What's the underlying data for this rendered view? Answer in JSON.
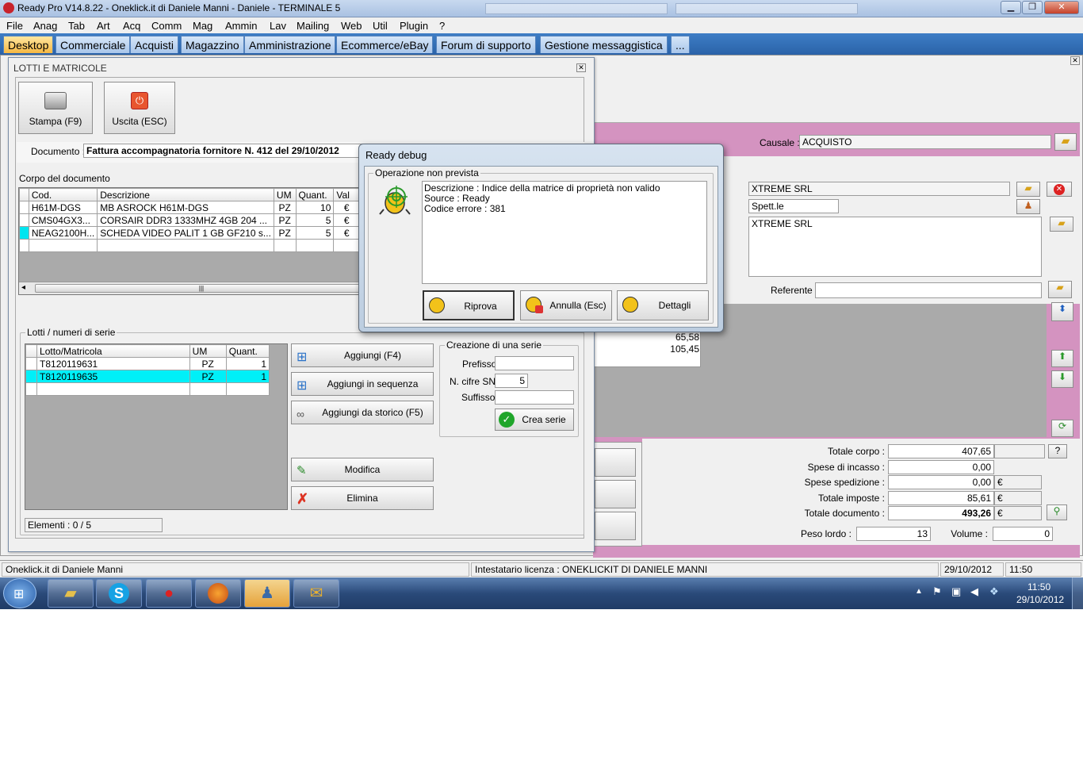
{
  "window": {
    "title": "Ready Pro V14.8.22 - Oneklick.it di Daniele Manni - Daniele - TERMINALE 5"
  },
  "menu": [
    "File",
    "Anag",
    "Tab",
    "Art",
    "Acq",
    "Comm",
    "Mag",
    "Ammin",
    "Lav",
    "Mailing",
    "Web",
    "Util",
    "Plugin",
    "?"
  ],
  "tabs": [
    "Desktop",
    "Commerciale",
    "Acquisti",
    "Magazzino",
    "Amministrazione",
    "Ecommerce/eBay",
    "Forum di supporto",
    "Gestione messaggistica",
    "..."
  ],
  "lotti": {
    "title": "LOTTI E MATRICOLE",
    "stampa_label": "Stampa (F9)",
    "uscita_label": "Uscita (ESC)",
    "documento_label": "Documento :",
    "documento_value": "Fattura accompagnatoria fornitore N. 412 del 29/10/2012",
    "corpo_label": "Corpo del documento",
    "corpo_headers": [
      "Cod.",
      "Descrizione",
      "UM",
      "Quant.",
      "Val"
    ],
    "corpo_rows": [
      [
        "H61M-DGS",
        "MB ASROCK H61M-DGS",
        "PZ",
        "10",
        "€"
      ],
      [
        "CMS04GX3...",
        "CORSAIR DDR3 1333MHZ 4GB 204 ...",
        "PZ",
        "5",
        "€"
      ],
      [
        "NEAG2100H...",
        "SCHEDA VIDEO PALIT 1 GB GF210 s...",
        "PZ",
        "5",
        "€"
      ]
    ],
    "serie_label": "Lotti / numeri di serie",
    "serie_headers": [
      "Lotto/Matricola",
      "UM",
      "Quant."
    ],
    "serie_rows": [
      [
        "T8120119631",
        "PZ",
        "1"
      ],
      [
        "T8120119635",
        "PZ",
        "1"
      ]
    ],
    "aggiungi_label": "Aggiungi (F4)",
    "aggiungi_seq_label": "Aggiungi in sequenza",
    "aggiungi_storico_label": "Aggiungi da storico (F5)",
    "modifica_label": "Modifica",
    "elimina_label": "Elimina",
    "creazione_label": "Creazione di una serie",
    "prefisso_label": "Prefisso",
    "ncifre_label": "N. cifre SN",
    "ncifre_value": "5",
    "suffisso_label": "Suffisso",
    "crea_serie_label": "Crea serie",
    "elementi": "Elementi : 0 / 5"
  },
  "document": {
    "causale_label": "Causale :",
    "causale_value": "ACQUISTO",
    "fornitore": "XTREME SRL",
    "titolo": "Spett.le",
    "indirizzo": "XTREME SRL",
    "referente_label": "Referente",
    "grid_values": [
      "65,58",
      "105,45"
    ],
    "totale_corpo_label": "Totale corpo :",
    "totale_corpo": "407,65",
    "spese_incasso_label": "Spese di incasso :",
    "spese_incasso": "0,00",
    "spese_spedizione_label": "Spese spedizione :",
    "spese_spedizione": "0,00",
    "totale_imposte_label": "Totale imposte :",
    "totale_imposte": "85,61",
    "totale_documento_label": "Totale documento :",
    "totale_documento": "493,26",
    "currency": "€",
    "help": "?",
    "peso_label": "Peso lordo :",
    "peso_value": "13",
    "volume_label": "Volume :",
    "volume_value": "0"
  },
  "debug": {
    "title": "Ready debug",
    "group": "Operazione non prevista",
    "line1": "Descrizione : Indice della matrice di proprietà non valido",
    "line2": "Source : Ready",
    "line3": "Codice errore : 381",
    "riprova": "Riprova",
    "annulla": "Annulla (Esc)",
    "dettagli": "Dettagli"
  },
  "status": {
    "company": "Oneklick.it di Daniele Manni",
    "licenza": "Intestatario licenza : ONEKLICKIT DI DANIELE MANNI",
    "date": "29/10/2012",
    "time": "11:50"
  },
  "taskbar": {
    "time": "11:50",
    "date": "29/10/2012"
  }
}
